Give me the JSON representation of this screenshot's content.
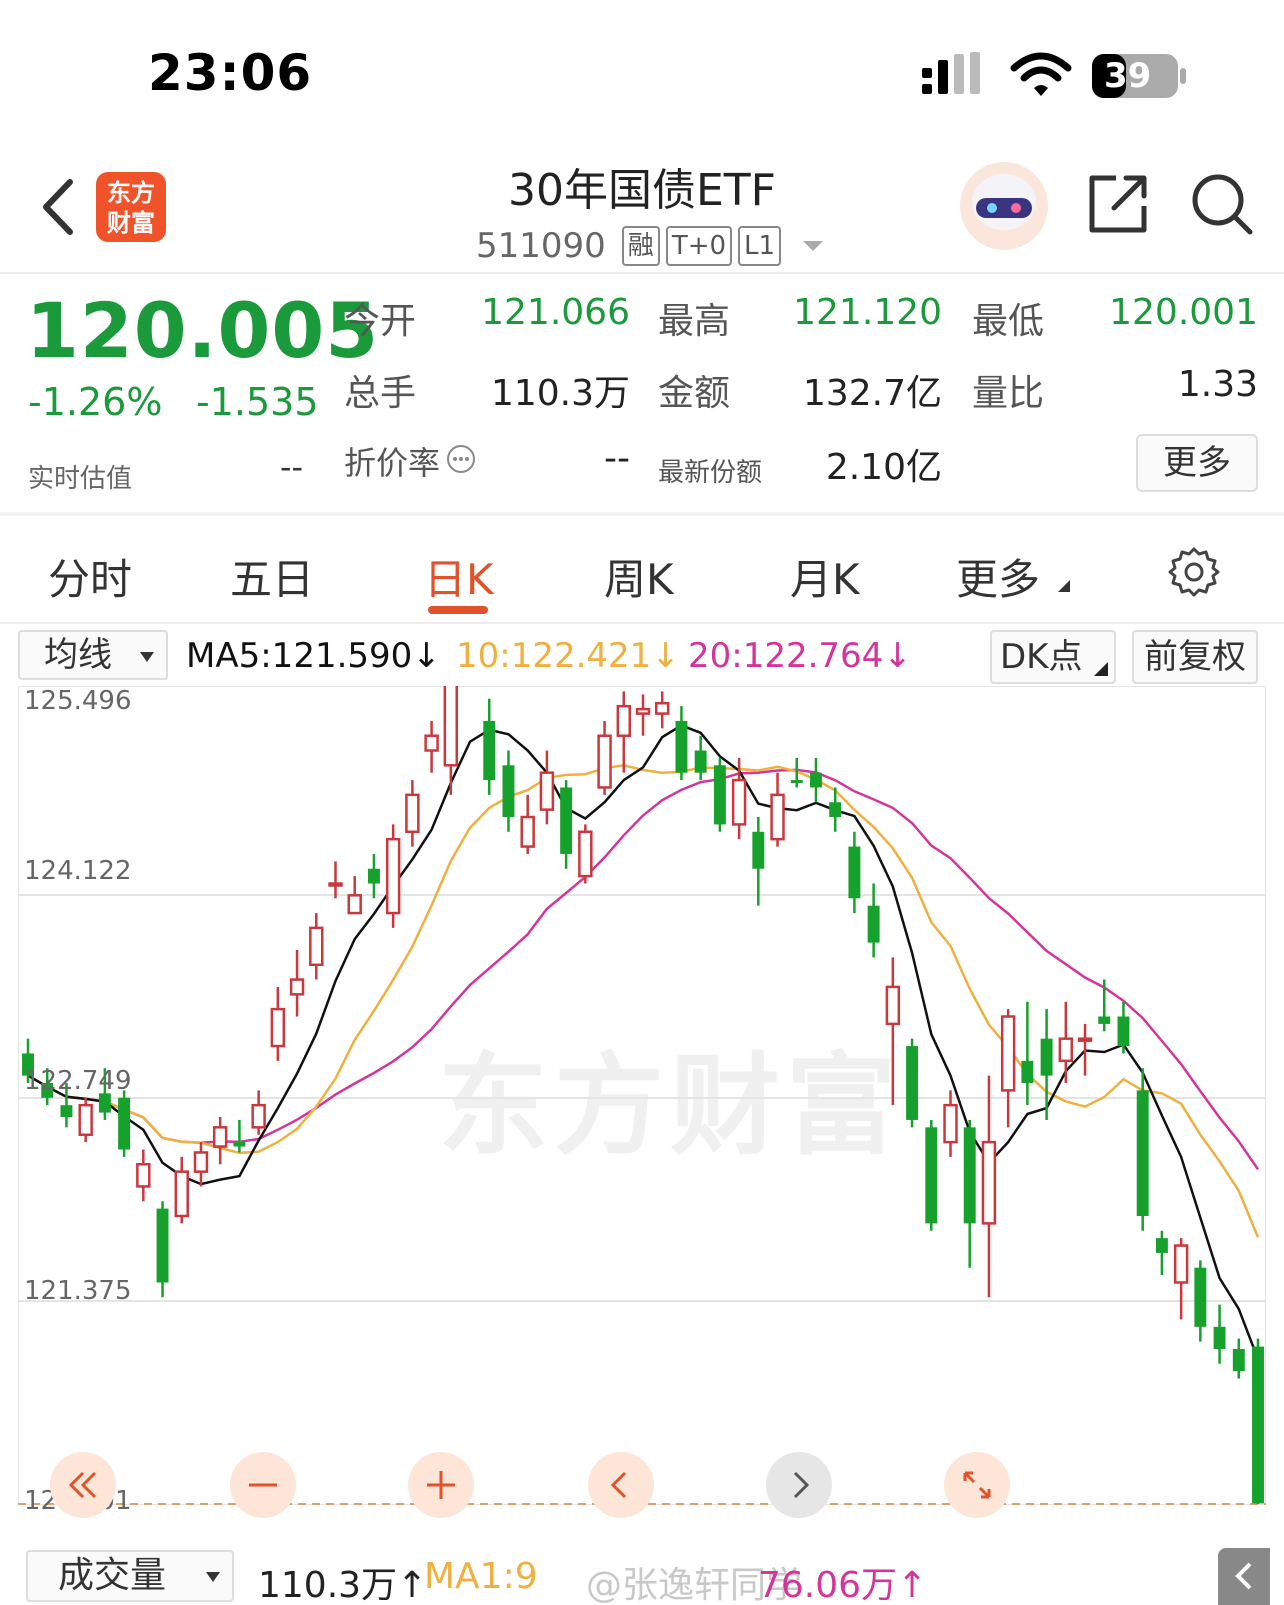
{
  "status_bar": {
    "time": "23:06",
    "battery": "39"
  },
  "header": {
    "logo_line1": "东方",
    "logo_line2": "财富",
    "title": "30年国债ETF",
    "code": "511090",
    "tags": [
      "融",
      "T+0",
      "L1"
    ]
  },
  "quote": {
    "price": "120.005",
    "change_pct": "-1.26%",
    "change_amt": "-1.535",
    "estimate_label": "实时估值",
    "estimate_value": "--",
    "fields": [
      {
        "label": "今开",
        "value": "121.066",
        "color": "green"
      },
      {
        "label": "最高",
        "value": "121.120",
        "color": "green"
      },
      {
        "label": "最低",
        "value": "120.001",
        "color": "green"
      },
      {
        "label": "总手",
        "value": "110.3万",
        "color": "black"
      },
      {
        "label": "金额",
        "value": "132.7亿",
        "color": "black"
      },
      {
        "label": "量比",
        "value": "1.33",
        "color": "black"
      },
      {
        "label": "折价率",
        "value": "--",
        "color": "black"
      },
      {
        "label": "最新份额",
        "value": "2.10亿",
        "color": "black"
      }
    ],
    "more_label": "更多"
  },
  "tabs": {
    "items": [
      "分时",
      "五日",
      "日K",
      "周K",
      "月K",
      "更多"
    ],
    "active": "日K"
  },
  "ma_bar": {
    "select_label": "均线",
    "ma5": "MA5:121.590↓",
    "ma10": "10:122.421↓",
    "ma20": "20:122.764↓",
    "dk_label": "DK点",
    "adjust_label": "前复权",
    "colors": {
      "ma5": "#111111",
      "ma10": "#f0b040",
      "ma20": "#d4359a"
    }
  },
  "chart_data": {
    "type": "candlestick",
    "y_ticks": [
      "125.496",
      "124.122",
      "122.749",
      "121.375",
      "120.001"
    ],
    "ylim": [
      120.001,
      125.496
    ],
    "watermark": "东方财富",
    "candles": [
      [
        123.05,
        122.9,
        123.15,
        122.85
      ],
      [
        122.85,
        122.75,
        122.95,
        122.7
      ],
      [
        122.7,
        122.62,
        122.85,
        122.55
      ],
      [
        122.5,
        122.7,
        122.75,
        122.45
      ],
      [
        122.78,
        122.65,
        122.95,
        122.6
      ],
      [
        122.75,
        122.4,
        122.8,
        122.35
      ],
      [
        122.15,
        122.3,
        122.4,
        122.05
      ],
      [
        122.0,
        121.5,
        122.05,
        121.4
      ],
      [
        121.95,
        122.25,
        122.35,
        121.9
      ],
      [
        122.25,
        122.38,
        122.45,
        122.15
      ],
      [
        122.42,
        122.55,
        122.62,
        122.3
      ],
      [
        122.45,
        122.42,
        122.6,
        122.38
      ],
      [
        122.55,
        122.7,
        122.8,
        122.5
      ],
      [
        123.1,
        123.35,
        123.5,
        123.0
      ],
      [
        123.45,
        123.55,
        123.75,
        123.3
      ],
      [
        123.65,
        123.9,
        124.0,
        123.55
      ],
      [
        124.2,
        124.2,
        124.35,
        124.1
      ],
      [
        124.0,
        124.12,
        124.25,
        124.0
      ],
      [
        124.3,
        124.2,
        124.4,
        124.1
      ],
      [
        124.0,
        124.5,
        124.6,
        123.9
      ],
      [
        124.55,
        124.8,
        124.9,
        124.45
      ],
      [
        125.1,
        125.2,
        125.3,
        124.95
      ],
      [
        125.0,
        125.7,
        125.8,
        124.8
      ],
      [
        125.9,
        125.6,
        125.9,
        125.55
      ],
      [
        125.3,
        124.9,
        125.45,
        124.8
      ],
      [
        125.0,
        124.65,
        125.1,
        124.55
      ],
      [
        124.45,
        124.65,
        124.8,
        124.4
      ],
      [
        124.7,
        124.95,
        125.1,
        124.6
      ],
      [
        124.85,
        124.4,
        124.9,
        124.3
      ],
      [
        124.25,
        124.55,
        124.6,
        124.2
      ],
      [
        124.85,
        125.2,
        125.3,
        124.8
      ],
      [
        125.2,
        125.4,
        125.5,
        124.95
      ],
      [
        125.35,
        125.38,
        125.48,
        125.2
      ],
      [
        125.35,
        125.42,
        125.5,
        125.25
      ],
      [
        125.3,
        124.95,
        125.4,
        124.9
      ],
      [
        125.1,
        124.95,
        125.2,
        124.9
      ],
      [
        125.0,
        124.6,
        125.05,
        124.55
      ],
      [
        124.6,
        124.9,
        125.05,
        124.5
      ],
      [
        124.55,
        124.3,
        124.65,
        124.05
      ],
      [
        124.5,
        124.8,
        124.95,
        124.45
      ],
      [
        124.9,
        124.88,
        125.05,
        124.85
      ],
      [
        124.95,
        124.85,
        125.05,
        124.75
      ],
      [
        124.75,
        124.65,
        124.85,
        124.55
      ],
      [
        124.45,
        124.1,
        124.55,
        124.0
      ],
      [
        124.05,
        123.8,
        124.2,
        123.7
      ],
      [
        123.25,
        123.5,
        123.7,
        122.7
      ],
      [
        123.1,
        122.6,
        123.15,
        122.55
      ],
      [
        122.55,
        121.9,
        122.6,
        121.85
      ],
      [
        122.45,
        122.7,
        122.8,
        122.35
      ],
      [
        122.55,
        121.9,
        122.6,
        121.6
      ],
      [
        121.9,
        122.45,
        122.9,
        121.4
      ],
      [
        122.8,
        123.3,
        123.35,
        122.55
      ],
      [
        123.0,
        122.85,
        123.4,
        122.7
      ],
      [
        123.15,
        122.9,
        123.35,
        122.6
      ],
      [
        123.0,
        123.15,
        123.4,
        122.85
      ],
      [
        123.15,
        123.15,
        123.25,
        122.9
      ],
      [
        123.3,
        123.25,
        123.55,
        123.2
      ],
      [
        123.3,
        123.1,
        123.4,
        123.05
      ],
      [
        122.8,
        121.95,
        122.95,
        121.85
      ],
      [
        121.8,
        121.7,
        121.85,
        121.55
      ],
      [
        121.5,
        121.75,
        121.8,
        121.25
      ],
      [
        121.6,
        121.2,
        121.65,
        121.1
      ],
      [
        121.2,
        121.05,
        121.35,
        120.95
      ],
      [
        121.05,
        120.9,
        121.12,
        120.85
      ],
      [
        121.066,
        120.005,
        121.12,
        120.001
      ]
    ]
  },
  "controls": [
    "double-left",
    "zoom-out",
    "zoom-in",
    "prev",
    "next",
    "fullscreen"
  ],
  "volume_bar": {
    "select_label": "成交量",
    "volume": "110.3万↑",
    "ma1": "MA1:9",
    "ma2": "76.06万↑",
    "watermark": "@张逸轩同学",
    "colors": {
      "ma1": "#f0b040",
      "ma2": "#d4359a"
    }
  }
}
